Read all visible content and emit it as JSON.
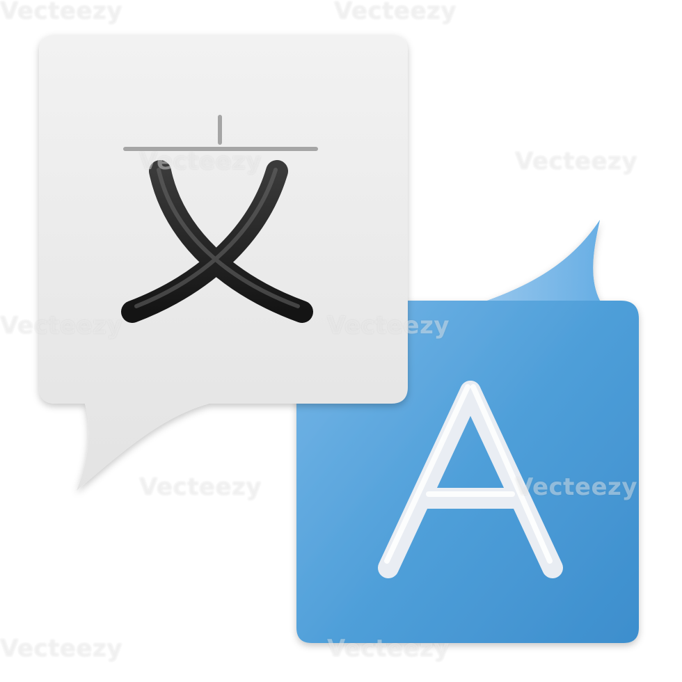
{
  "icon": {
    "name": "translate-icon",
    "source_glyph": "文",
    "target_glyph": "A"
  },
  "colors": {
    "source_bubble": "#e9e9e9",
    "source_glyph": "#1c1c1c",
    "target_bubble": "#5aa6dc",
    "target_glyph": "#f1f3f7"
  },
  "watermark": {
    "text": "Vecteezy"
  }
}
